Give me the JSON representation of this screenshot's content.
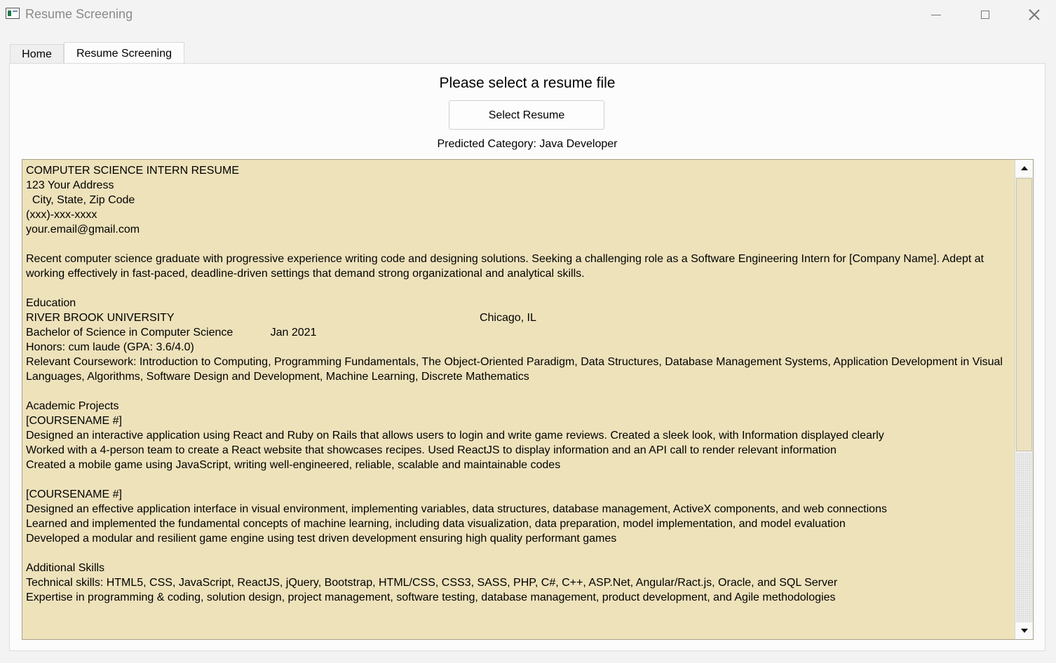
{
  "window": {
    "title": "Resume Screening"
  },
  "tabs": [
    {
      "label": "Home"
    },
    {
      "label": "Resume Screening"
    }
  ],
  "panel": {
    "prompt": "Please select a resume file",
    "select_button_label": "Select Resume",
    "predicted_category": "Predicted Category: Java Developer"
  },
  "resume_text": "COMPUTER SCIENCE INTERN RESUME\n123 Your Address\n  City, State, Zip Code\n(xxx)-xxx-xxxx\nyour.email@gmail.com\n\nRecent computer science graduate with progressive experience writing code and designing solutions. Seeking a challenging role as a Software Engineering Intern for [Company Name]. Adept at working effectively in fast-paced, deadline-driven settings that demand strong organizational and analytical skills.\n\nEducation\nRIVER BROOK UNIVERSITY                                                                                                  Chicago, IL\nBachelor of Science in Computer Science            Jan 2021\nHonors: cum laude (GPA: 3.6/4.0)\nRelevant Coursework: Introduction to Computing, Programming Fundamentals, The Object-Oriented Paradigm, Data Structures, Database Management Systems, Application Development in Visual Languages, Algorithms, Software Design and Development, Machine Learning, Discrete Mathematics\n\nAcademic Projects\n[COURSENAME #]\nDesigned an interactive application using React and Ruby on Rails that allows users to login and write game reviews. Created a sleek look, with Information displayed clearly\nWorked with a 4-person team to create a React website that showcases recipes. Used ReactJS to display information and an API call to render relevant information\nCreated a mobile game using JavaScript, writing well-engineered, reliable, scalable and maintainable codes\n\n[COURSENAME #]\nDesigned an effective application interface in visual environment, implementing variables, data structures, database management, ActiveX components, and web connections\nLearned and implemented the fundamental concepts of machine learning, including data visualization, data preparation, model implementation, and model evaluation\nDeveloped a modular and resilient game engine using test driven development ensuring high quality performant games\n\nAdditional Skills\nTechnical skills: HTML5, CSS, JavaScript, ReactJS, jQuery, Bootstrap, HTML/CSS, CSS3, SASS, PHP, C#, C++, ASP.Net, Angular/Ract.js, Oracle, and SQL Server\nExpertise in programming & coding, solution design, project management, software testing, database management, product development, and Agile methodologies",
  "icons": {
    "app": "app-window-icon",
    "minimize": "minimize-icon",
    "maximize": "maximize-icon",
    "close": "close-icon"
  },
  "colors": {
    "text_area_background": "#eee2bb",
    "window_background": "#f3f3f3"
  }
}
